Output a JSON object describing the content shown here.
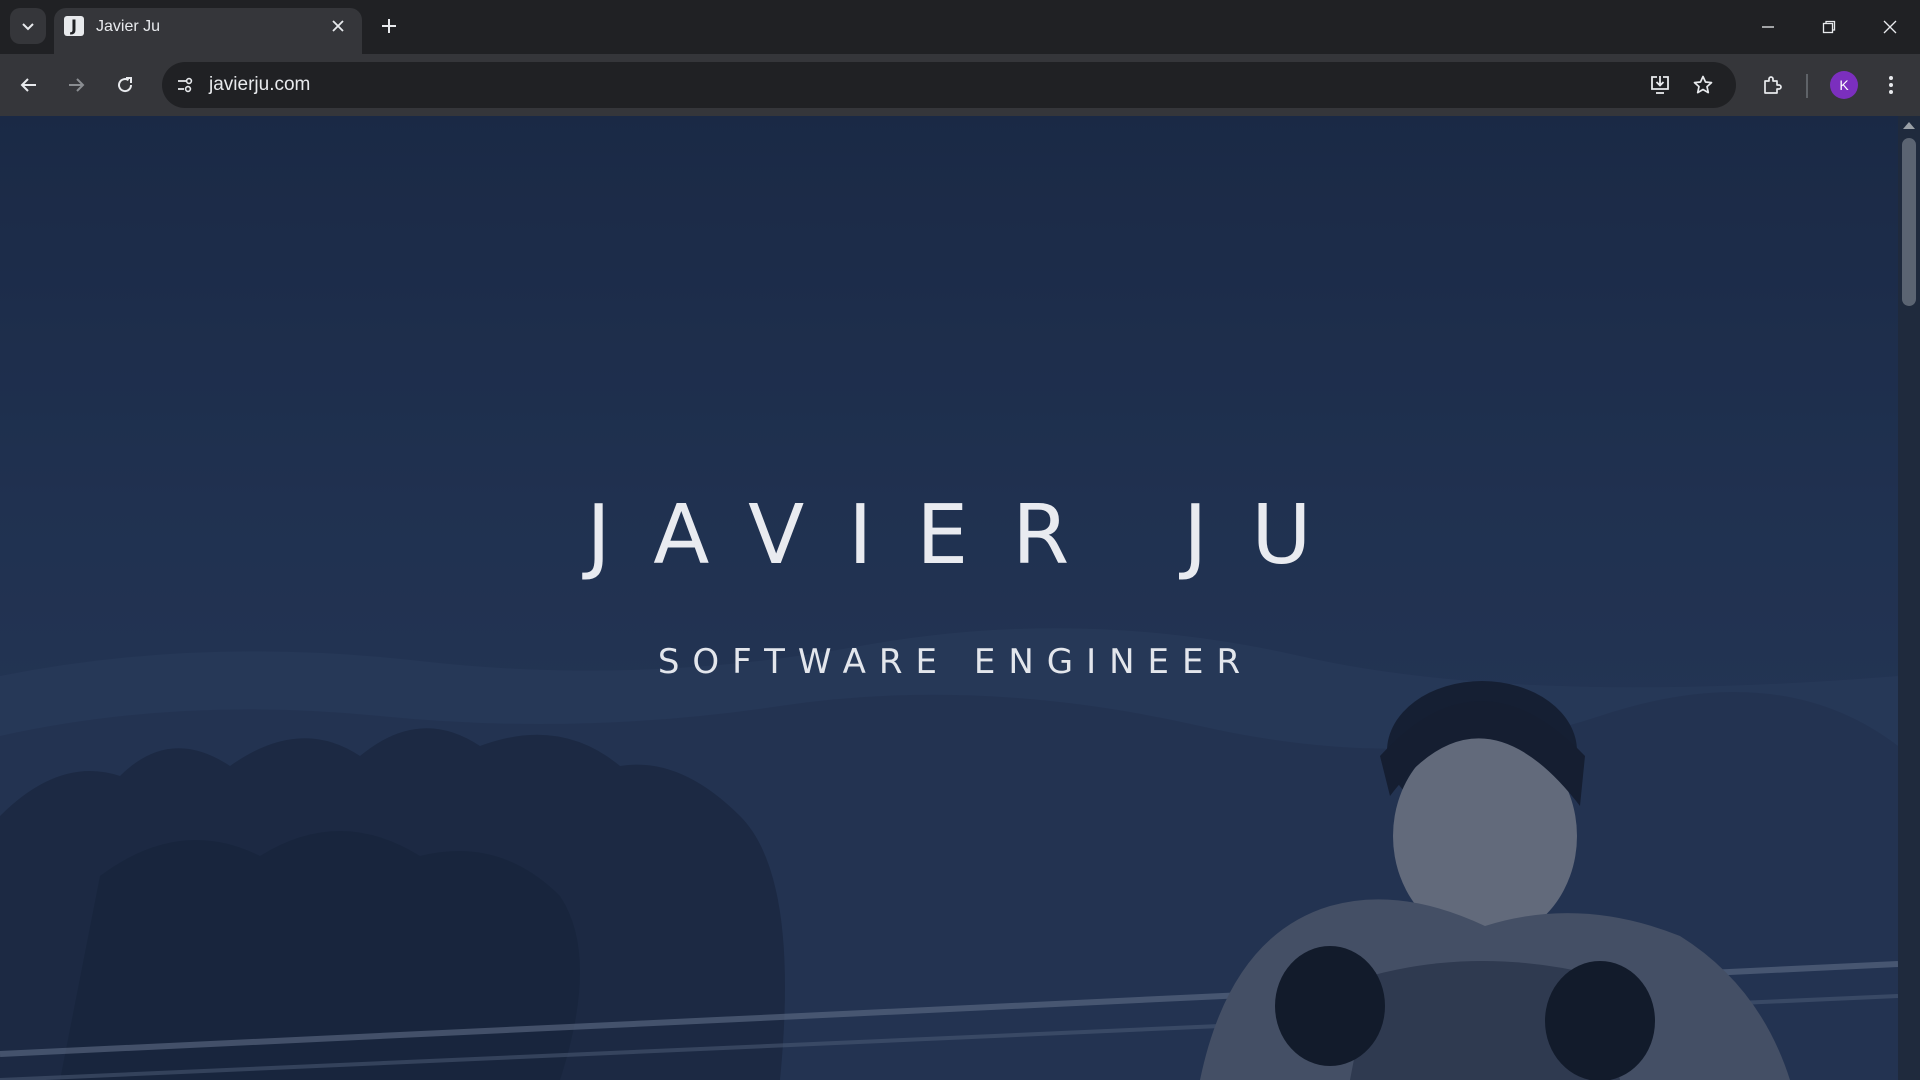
{
  "browser": {
    "tab": {
      "favicon_letter": "J",
      "title": "Javier Ju"
    },
    "omnibox": {
      "url": "javierju.com"
    },
    "profile": {
      "initial": "K",
      "color": "#7b2fbe"
    },
    "icons": [
      "tab-search-icon",
      "close-icon",
      "plus-icon",
      "minimize-icon",
      "restore-icon",
      "window-close-icon",
      "back-arrow-icon",
      "forward-arrow-icon",
      "reload-icon",
      "site-info-icon",
      "install-app-icon",
      "bookmark-star-icon",
      "extensions-icon",
      "menu-dots-icon"
    ]
  },
  "hero": {
    "name": "JAVIER JU",
    "subtitle": "SOFTWARE ENGINEER"
  }
}
